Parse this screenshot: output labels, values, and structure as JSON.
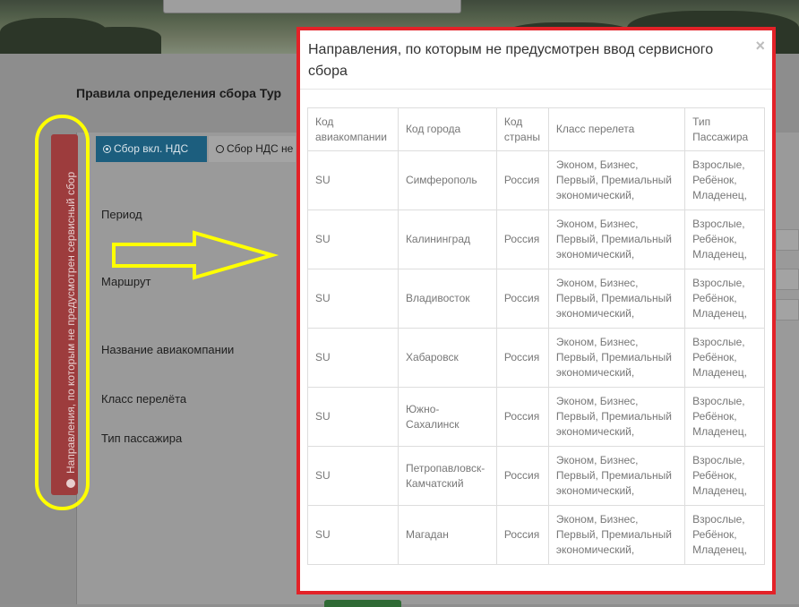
{
  "page": {
    "title": "Правила определения сбора Тур",
    "tabs": [
      {
        "label": "Сбор вкл. НДС",
        "active": true
      },
      {
        "label": "Сбор НДС не",
        "active": false
      }
    ],
    "form_labels": {
      "period": "Период",
      "route": "Маршрут",
      "airline_name": "Название авиакомпании",
      "flight_class": "Класс перелёта",
      "passenger_type": "Тип пассажира"
    }
  },
  "side_tab": {
    "label": "Направления, по которым не предусмотрен сервисный сбор",
    "icon": "info-icon",
    "color": "#9d3c3d"
  },
  "annotations": {
    "highlight_color": "#ffff00",
    "modal_border_color": "#e32228"
  },
  "modal": {
    "title": "Направления, по которым не предусмотрен ввод сервисного сбора",
    "close_label": "×",
    "columns": [
      "Код авиакомпании",
      "Код города",
      "Код страны",
      "Класс перелета",
      "Тип Пассажира"
    ],
    "rows": [
      {
        "airline": "SU",
        "city": "Симферополь",
        "country": "Россия",
        "class": "Эконом, Бизнес, Первый, Премиальный экономический,",
        "passenger": "Взрослые, Ребёнок, Младенец,"
      },
      {
        "airline": "SU",
        "city": "Калининград",
        "country": "Россия",
        "class": "Эконом, Бизнес, Первый, Премиальный экономический,",
        "passenger": "Взрослые, Ребёнок, Младенец,"
      },
      {
        "airline": "SU",
        "city": "Владивосток",
        "country": "Россия",
        "class": "Эконом, Бизнес, Первый, Премиальный экономический,",
        "passenger": "Взрослые, Ребёнок, Младенец,"
      },
      {
        "airline": "SU",
        "city": "Хабаровск",
        "country": "Россия",
        "class": "Эконом, Бизнес, Первый, Премиальный экономический,",
        "passenger": "Взрослые, Ребёнок, Младенец,"
      },
      {
        "airline": "SU",
        "city": "Южно-Сахалинск",
        "country": "Россия",
        "class": "Эконом, Бизнес, Первый, Премиальный экономический,",
        "passenger": "Взрослые, Ребёнок, Младенец,"
      },
      {
        "airline": "SU",
        "city": "Петропавловск-Камчатский",
        "country": "Россия",
        "class": "Эконом, Бизнес, Первый, Премиальный экономический,",
        "passenger": "Взрослые, Ребёнок, Младенец,"
      },
      {
        "airline": "SU",
        "city": "Магадан",
        "country": "Россия",
        "class": "Эконом, Бизнес, Первый, Премиальный экономический,",
        "passenger": "Взрослые, Ребёнок, Младенец,"
      }
    ]
  }
}
